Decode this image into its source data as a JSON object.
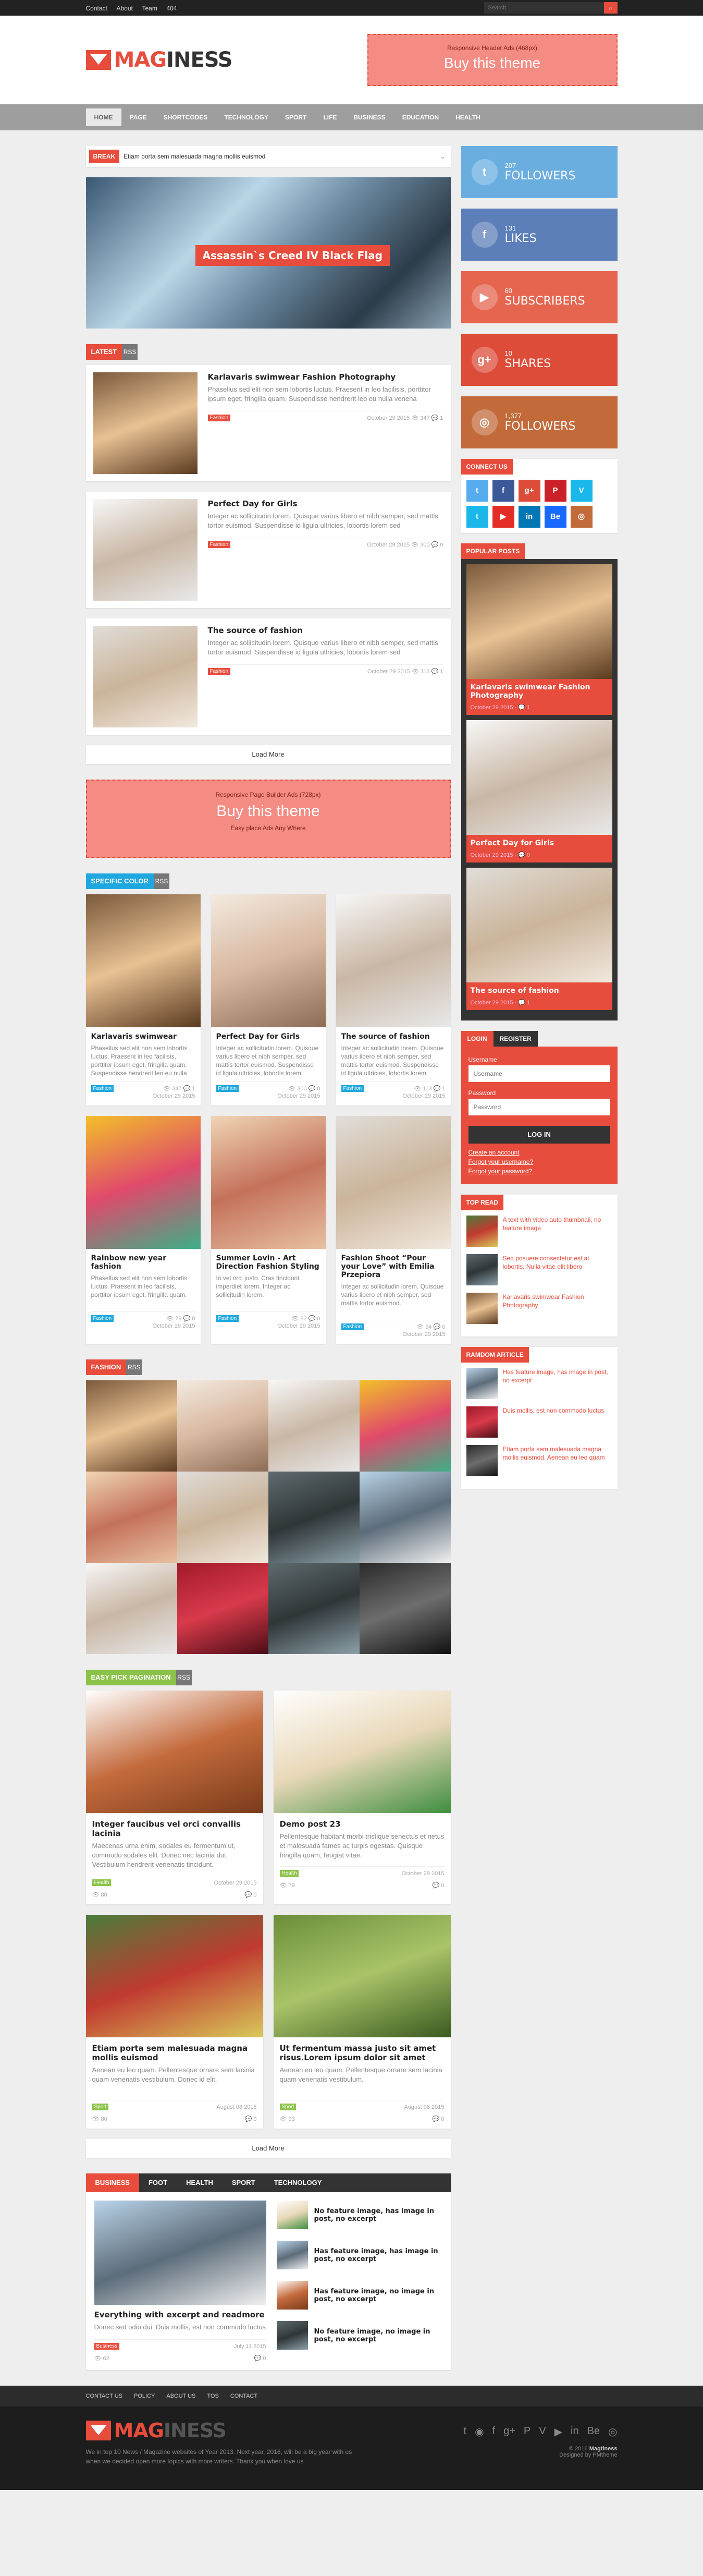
{
  "topbar": {
    "links": [
      "Contact",
      "About",
      "Team",
      "404"
    ],
    "search_placeholder": "Search"
  },
  "logo": {
    "part1": "MAG",
    "part2": "INESS"
  },
  "header_ad": {
    "subtitle": "Responsive Header Ads (468px)",
    "title": "Buy this theme"
  },
  "nav": [
    "HOME",
    "PAGE",
    "SHORTCODES",
    "TECHNOLOGY",
    "SPORT",
    "LIFE",
    "BUSINESS",
    "EDUCATION",
    "HEALTH"
  ],
  "breaking": {
    "label": "BREAK",
    "text": "Etiam porta sem malesuada magna mollis euismod"
  },
  "hero": {
    "caption": "Assassin`s Creed IV Black Flag"
  },
  "latest": {
    "label": "LATEST",
    "rss": "RSS",
    "posts": [
      {
        "title": "Karlavaris swimwear Fashion Photography",
        "excerpt": "Phasellus sed elit non sem lobortis luctus. Praesent in leo facilisis, porttitor ipsum eget, fringilla quam. Suspendisse hendrerit leo eu nulla venena",
        "tag": "Fashion",
        "date": "October 29 2015",
        "views": "347",
        "comments": "1"
      },
      {
        "title": "Perfect Day for Girls",
        "excerpt": "Integer ac sollicitudin lorem. Quisque varius libero et nibh semper, sed mattis tortor euismod. Suspendisse id ligula ultricies, lobortis lorem sed",
        "tag": "Fashion",
        "date": "October 29 2015",
        "views": "300",
        "comments": "0"
      },
      {
        "title": "The source of fashion",
        "excerpt": "Integer ac sollicitudin lorem. Quisque varius libero et nibh semper, sed mattis tortor euismod. Suspendisse id ligula ultricies, lobortis lorem sed",
        "tag": "Fashion",
        "date": "October 29 2015",
        "views": "113",
        "comments": "1"
      }
    ],
    "load_more": "Load More"
  },
  "page_ad": {
    "subtitle": "Responsive Page Builder Ads (728px)",
    "title": "Buy this theme",
    "link": "Easy place Ads Any Where"
  },
  "specific": {
    "label": "SPECIFIC COLOR",
    "rss": "RSS",
    "posts": [
      {
        "title": "Karlavaris swimwear",
        "excerpt": "Phasellus sed elit non sem lobortis luctus. Praesent in leo facilisis, porttitor ipsum eget, fringilla quam. Suspendisse hendrerit leo eu nulla venenatis.",
        "tag": "Fashion",
        "date": "October 29 2015",
        "views": "347",
        "comments": "1"
      },
      {
        "title": "Perfect Day for Girls",
        "excerpt": "Integer ac sollicitudin lorem. Quisque varius libero et nibh semper, sed mattis tortor euismod. Suspendisse id ligula ultricies, lobortis lorem.",
        "tag": "Fashion",
        "date": "October 29 2015",
        "views": "300",
        "comments": "0"
      },
      {
        "title": "The source of fashion",
        "excerpt": "Integer ac sollicitudin lorem. Quisque varius libero et nibh semper, sed mattis tortor euismod. Suspendisse id ligula ultricies, lobortis lorem.",
        "tag": "Fashion",
        "date": "October 29 2015",
        "views": "113",
        "comments": "1"
      },
      {
        "title": "Rainbow new year fashion",
        "excerpt": "Phasellus sed elit non sem lobortis luctus. Praesent in leo facilisis, porttitor ipsum eget, fringilla quam.",
        "tag": "Fashion",
        "date": "October 29 2015",
        "views": "79",
        "comments": "0"
      },
      {
        "title": "Summer Lovin - Art Direction Fashion Styling",
        "excerpt": "In vel orci justo. Cras tincidunt imperdiet lorem. Integer ac sollicitudin lorem.",
        "tag": "Fashion",
        "date": "October 29 2015",
        "views": "82",
        "comments": "0"
      },
      {
        "title": "Fashion Shoot “Pour your Love” with Emilia Przepiora",
        "excerpt": "Integer ac sollicitudin lorem. Quisque varius libero et nibh semper, sed mattis tortor euismod.",
        "tag": "Fashion",
        "date": "October 29 2015",
        "views": "94",
        "comments": "0"
      }
    ]
  },
  "fashion": {
    "label": "FASHION",
    "rss": "RSS"
  },
  "easy": {
    "label": "EASY PICK PAGINATION",
    "rss": "RSS",
    "posts": [
      {
        "title": "Integer faucibus vel orci convallis lacinia",
        "excerpt": "Maecenas urna enim, sodales eu fermentum ut, commodo sodales elit. Donec nec lacinia dui. Vestibulum hendrerit venenatis tincidunt.",
        "tag": "Health",
        "date": "October 29 2015",
        "views": "80",
        "comments": "0"
      },
      {
        "title": "Demo post 23",
        "excerpt": "Pellentesque habitant morbi tristique senectus et netus et malesuada fames ac turpis egestas. Quisque fringilla quam, feugiat vitae.",
        "tag": "Health",
        "date": "October 29 2015",
        "views": "79",
        "comments": "0"
      },
      {
        "title": "Etiam porta sem malesuada magna mollis euismod",
        "excerpt": "Aenean eu leo quam. Pellentesque ornare sem lacinia quam venenatis vestibulum. Donec id elit.",
        "tag": "Sport",
        "date": "August 08 2015",
        "views": "80",
        "comments": "0"
      },
      {
        "title": "Ut fermentum massa justo sit amet risus.Lorem ipsum dolor sit amet",
        "excerpt": "Aenean eu leo quam. Pellentesque ornare sem lacinia quam venenatis vestibulum.",
        "tag": "Sport",
        "date": "August 08 2015",
        "views": "93",
        "comments": "0"
      }
    ],
    "load_more": "Load More"
  },
  "tabs": {
    "items": [
      "BUSINESS",
      "FOOT",
      "HEALTH",
      "SPORT",
      "TECHNOLOGY"
    ],
    "feature": {
      "title": "Everything with excerpt and readmore",
      "excerpt": "Donec sed odio dui. Duis mollis, est non commodo luctus",
      "tag": "Business",
      "date": "July 11 2015",
      "views": "62",
      "comments": "0"
    },
    "list": [
      "No feature image, has image in post, no excerpt",
      "Has feature image, has image in post, no excerpt",
      "Has feature image, no image in post, no excerpt",
      "No feature image, no image in post, no excerpt"
    ]
  },
  "sidebar": {
    "social": [
      {
        "count": "207",
        "label": "FOLLOWERS",
        "icon": "t",
        "color": "#6aaee0"
      },
      {
        "count": "131",
        "label": "LIKES",
        "icon": "f",
        "color": "#5c7eb9"
      },
      {
        "count": "60",
        "label": "SUBSCRIBERS",
        "icon": "▶",
        "color": "#e5654f"
      },
      {
        "count": "10",
        "label": "SHARES",
        "icon": "g+",
        "color": "#dd4b39"
      },
      {
        "count": "1,377",
        "label": "FOLLOWERS",
        "icon": "◎",
        "color": "#c26a3a"
      }
    ],
    "connect_label": "CONNECT US",
    "popular_label": "POPULAR POSTS",
    "popular": [
      {
        "title": "Karlavaris swimwear Fashion Photography",
        "date": "October 29 2015",
        "comments": "1"
      },
      {
        "title": "Perfect Day for Girls",
        "date": "October 29 2015",
        "comments": "0"
      },
      {
        "title": "The source of fashion",
        "date": "October 29 2015",
        "comments": "1"
      }
    ],
    "login": {
      "tab_login": "LOGIN",
      "tab_register": "REGISTER",
      "username_label": "Username",
      "username_ph": "Username",
      "password_label": "Password",
      "password_ph": "Password",
      "button": "LOG IN",
      "links": [
        "Create an account",
        "Forgot your username?",
        "Forgot your password?"
      ]
    },
    "top_read_label": "TOP READ",
    "top_read": [
      "A text with video auto thumbnail, no feature image",
      "Sed posuere consectetur est at lobortis. Nulla vitae elit libero",
      "Karlavaris swimwear Fashion Photography"
    ],
    "random_label": "RAMDOM ARTICLE",
    "random": [
      "Has feature image, has image in post, no excerpt",
      "Duis mollis, est non commodo luctus",
      "Etiam porta sem malesuada magna mollis euismod. Aenean eu leo quam"
    ]
  },
  "footer_nav": [
    "CONTACT US",
    "POLICY",
    "ABOUT US",
    "TOS",
    "CONTACT"
  ],
  "footer": {
    "text": "We in top 10 News / Magazine websites of Year 2013. Next year, 2016, will be a big year with us when we decided open more topics with more writers. Thank you when love us",
    "copyright": "© 2016",
    "brand": "Magtiness",
    "designed": "Designed by PMtheme",
    "icons": [
      "t",
      "◉",
      "f",
      "g+",
      "P",
      "V",
      "▶",
      "in",
      "Be",
      "◎"
    ]
  }
}
